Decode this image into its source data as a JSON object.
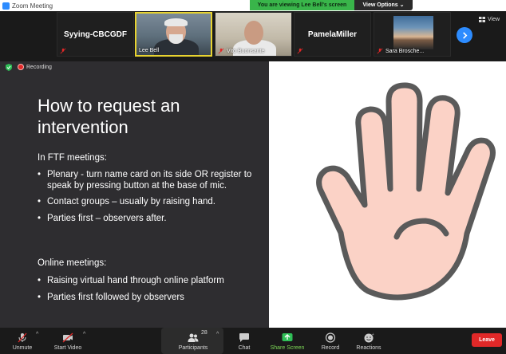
{
  "window": {
    "title": "Zoom Meeting"
  },
  "banner": {
    "message": "You are viewing Lee Bell's screen",
    "options_label": "View Options ⌄"
  },
  "filmstrip": {
    "participants": [
      {
        "name": "Syying-CBCGDF",
        "video": false
      },
      {
        "name": "Lee Bell",
        "video": true,
        "active_speaker": true
      },
      {
        "name": "Vito Buonsante",
        "video": true
      },
      {
        "name": "PamelaMiller",
        "video": false
      },
      {
        "name": "Sara Brosche...",
        "video": true
      }
    ],
    "view_label": "View"
  },
  "recording": {
    "label": "Recording"
  },
  "slide": {
    "title": "How to request an intervention",
    "section1": "In FTF meetings:",
    "bullets1": [
      "Plenary -  turn name card on its side OR register to speak by pressing button at the base of mic.",
      "Contact groups – usually by raising hand.",
      "Parties first – observers after."
    ],
    "section2": "Online meetings:",
    "bullets2": [
      "Raising virtual hand through online platform",
      "Parties first followed by observers"
    ],
    "image_icon": "raised-hand-icon"
  },
  "toolbar": {
    "unmute": "Unmute",
    "start_video": "Start Video",
    "participants": "Participants",
    "participants_count": "28",
    "chat": "Chat",
    "share_screen": "Share Screen",
    "record": "Record",
    "reactions": "Reactions",
    "leave": "Leave"
  },
  "colors": {
    "accent": "#2d8cff",
    "share_green": "#7ed957",
    "leave_red": "#e02828",
    "banner_green": "#39b54a",
    "hand_fill": "#fbd2c6",
    "hand_stroke": "#5a5a5a"
  }
}
